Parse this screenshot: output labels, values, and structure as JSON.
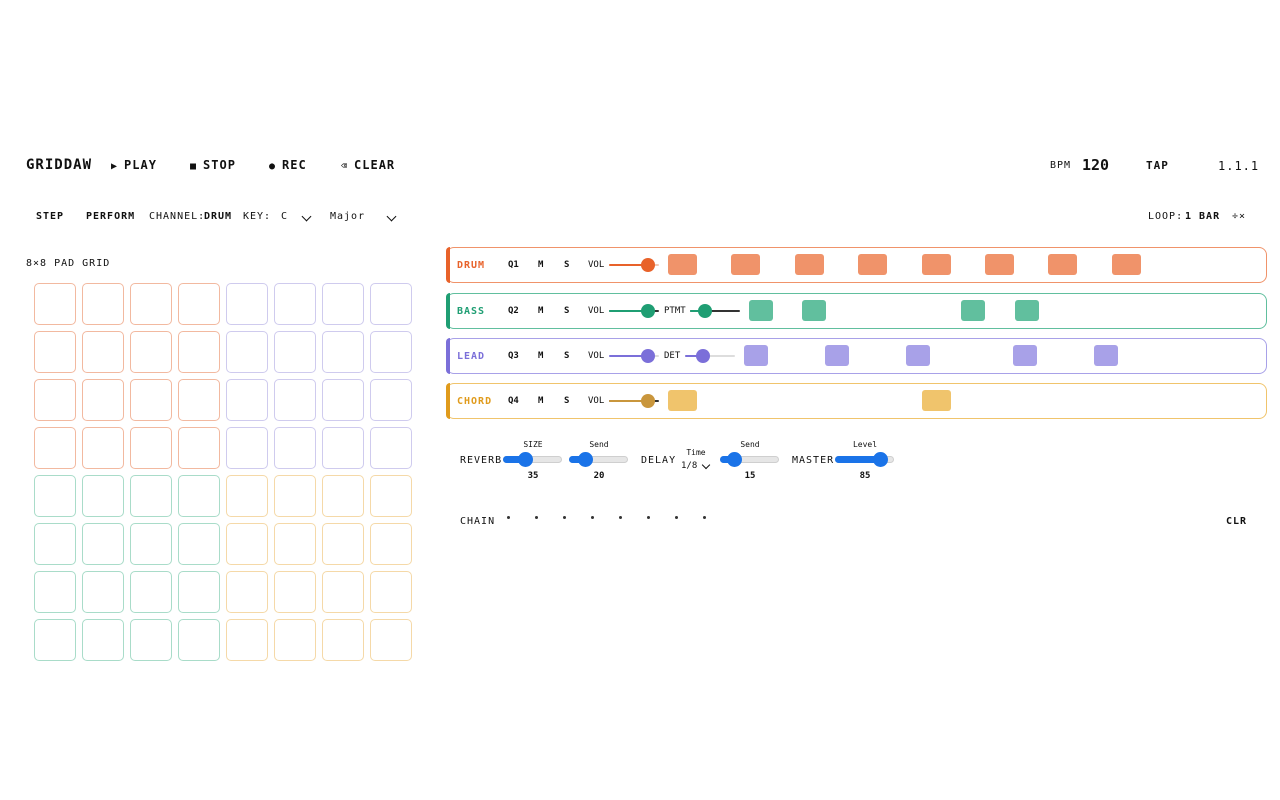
{
  "app": {
    "title": "GRIDDAW"
  },
  "transport": {
    "play": {
      "icon": "play-icon",
      "label": "PLAY"
    },
    "stop": {
      "icon": "stop-icon",
      "label": "STOP"
    },
    "rec": {
      "icon": "record-icon",
      "label": "REC"
    },
    "clear": {
      "icon": "backspace-icon",
      "label": "CLEAR"
    },
    "bpm_label": "BPM",
    "bpm_value": "120",
    "tap_label": "TAP",
    "position": "1.1.1"
  },
  "mode": {
    "step_label": "STEP",
    "perform_label": "PERFORM",
    "channel_label": "CHANNEL:",
    "channel_value": "DRUM",
    "key_label": "KEY:",
    "key_value": "C",
    "scale_value": "Major",
    "loop_label": "LOOP:",
    "loop_value": "1 BAR",
    "halve_label": "÷×"
  },
  "pad_grid": {
    "title": "8×8 PAD GRID",
    "quadrant_colors": {
      "drum": "#f2b9a0",
      "lead": "#cfcbee",
      "bass": "#a9dcc9",
      "chord": "#f5d9a8"
    }
  },
  "tracks": [
    {
      "name": "DRUM",
      "color": "#e8622a",
      "slider_color": "#e8622a",
      "step_color": "#f0936a",
      "quant": "Q1",
      "mute": "M",
      "solo": "S",
      "vol_label": "VOL",
      "vol": 0.77,
      "extra_label": "",
      "extra": null,
      "steps": [
        1,
        3,
        5,
        7,
        9,
        11,
        13,
        15
      ]
    },
    {
      "name": "BASS",
      "color": "#1f9e73",
      "slider_color": "#1f9e73",
      "step_color": "#61bf9e",
      "quant": "Q2",
      "mute": "M",
      "solo": "S",
      "vol_label": "VOL",
      "vol": 0.77,
      "extra_label": "PTMT",
      "extra": 0.3,
      "steps": [
        1,
        2,
        6,
        7
      ]
    },
    {
      "name": "LEAD",
      "color": "#7b6fd9",
      "slider_color": "#7b6fd9",
      "step_color": "#a8a1e8",
      "quant": "Q3",
      "mute": "M",
      "solo": "S",
      "vol_label": "VOL",
      "vol": 0.77,
      "extra_label": "DET",
      "extra": 0.35,
      "steps": [
        1,
        3,
        5,
        8,
        10
      ]
    },
    {
      "name": "CHORD",
      "color": "#e09b1c",
      "slider_color": "#c9963c",
      "step_color": "#f0c46c",
      "quant": "Q4",
      "mute": "M",
      "solo": "S",
      "vol_label": "VOL",
      "vol": 0.77,
      "extra_label": "",
      "extra": null,
      "steps": [
        1,
        9
      ]
    }
  ],
  "fx": {
    "reverb_label": "REVERB",
    "size_label": "SIZE",
    "size_value": "35",
    "rev_send_label": "Send",
    "rev_send_value": "20",
    "delay_label": "DELAY",
    "time_label": "Time",
    "time_value": "1/8",
    "del_send_label": "Send",
    "del_send_value": "15",
    "master_label": "MASTER",
    "level_label": "Level",
    "level_value": "85"
  },
  "chain": {
    "label": "CHAIN",
    "slots": 8,
    "clear_label": "CLR"
  },
  "colors": {
    "accent": "#1a73e8"
  }
}
